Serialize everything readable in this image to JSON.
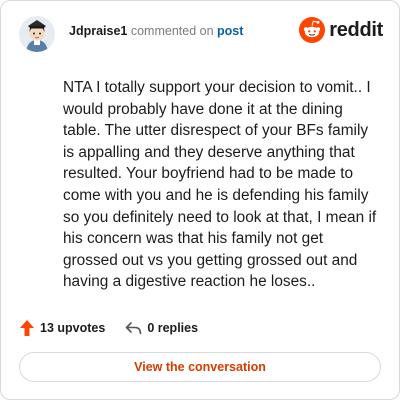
{
  "comment": {
    "username": "Jdpraise1",
    "action_text": "commented on",
    "target_link": "post",
    "body": "NTA I totally support your decision to vomit.. I would probably have done it at the dining table. The utter disrespect of your BFs family is appalling and they deserve anything that resulted. Your boyfriend had to be made to come with you and he is defending his family so you definitely need to look at that, I mean if his concern was that his family not get grossed out vs you getting grossed out and having a digestive reaction he loses.."
  },
  "brand": {
    "name": "reddit",
    "icon": "reddit-snoo-icon",
    "color": "#ff4500"
  },
  "actions": {
    "upvotes_label": "13 upvotes",
    "upvote_icon": "upvote-arrow-icon",
    "upvote_color": "#ff4500",
    "replies_label": "0 replies",
    "reply_icon": "reply-arrow-icon"
  },
  "cta": {
    "label": "View the conversation",
    "color": "#d93a00"
  }
}
